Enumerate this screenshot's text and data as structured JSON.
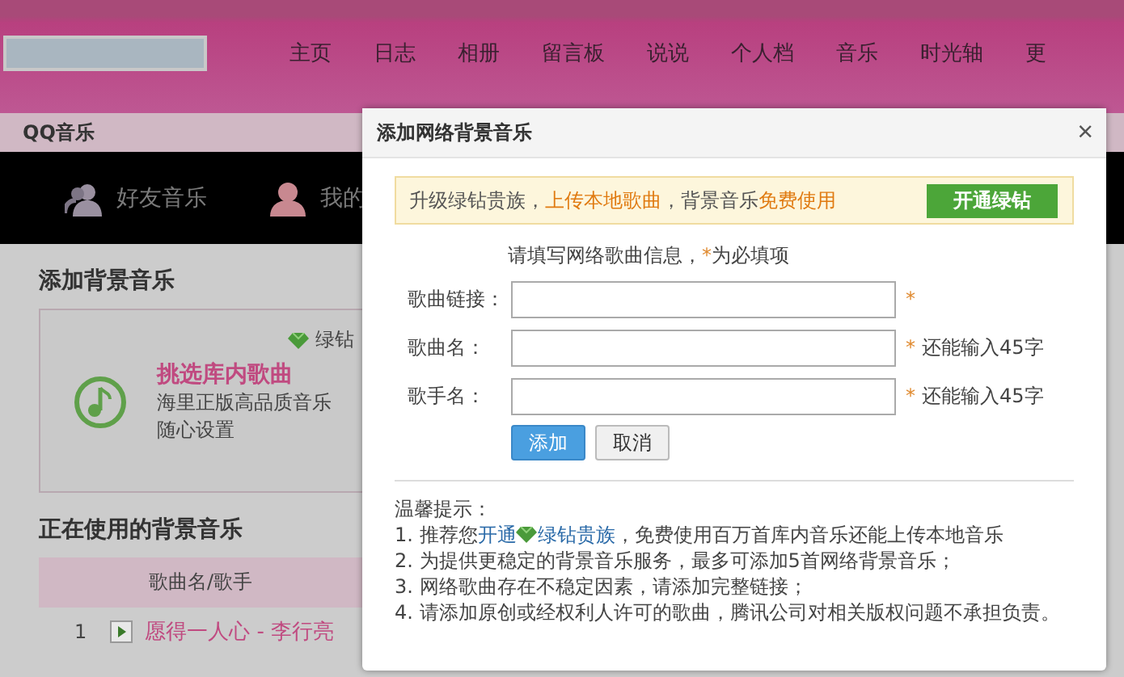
{
  "top_nav": {
    "items": [
      "主页",
      "日志",
      "相册",
      "留言板",
      "说说",
      "个人档",
      "音乐",
      "时光轴",
      "更"
    ]
  },
  "music_panel": {
    "title": "QQ音乐",
    "tabs": [
      {
        "label": "好友音乐",
        "kind": "friends"
      },
      {
        "label": "我的",
        "kind": "mine"
      }
    ],
    "add_section": {
      "heading": "添加背景音乐",
      "badge": "绿钻",
      "card_title": "挑选库内歌曲",
      "card_lines": [
        "海里正版高品质音乐",
        "随心设置"
      ]
    },
    "current_section": {
      "heading": "正在使用的背景音乐",
      "columns": [
        "歌曲名/歌手"
      ],
      "rows": [
        {
          "index": "1",
          "song": "愿得一人心 - 李行亮"
        }
      ]
    }
  },
  "dialog": {
    "title": "添加网络背景音乐",
    "close": "×",
    "promo": {
      "segments": [
        {
          "text": "升级绿钻贵族，",
          "kind": "text"
        },
        {
          "text": "上传本地歌曲",
          "kind": "link"
        },
        {
          "text": "，背景音乐",
          "kind": "text"
        },
        {
          "text": "免费使用",
          "kind": "link"
        }
      ],
      "button": "开通绿钻"
    },
    "intro": [
      {
        "text": "请填写网络歌曲信息，",
        "kind": "text"
      },
      {
        "text": "*",
        "kind": "mark"
      },
      {
        "text": "为必填项",
        "kind": "text"
      }
    ],
    "fields": [
      {
        "label": "歌曲链接：",
        "required": true,
        "star": "*"
      },
      {
        "label": "歌曲名：",
        "required": true,
        "star": "*",
        "counter": "还能输入45字"
      },
      {
        "label": "歌手名：",
        "required": true,
        "star": "*",
        "counter": "还能输入45字"
      }
    ],
    "buttons": [
      {
        "label": "添加",
        "kind": "primary"
      },
      {
        "label": "取消",
        "kind": "secondary"
      }
    ],
    "tips": {
      "title": "温馨提示：",
      "items": [
        [
          {
            "text": "1. 推荐您",
            "kind": "text"
          },
          {
            "text": "开通",
            "kind": "link"
          },
          {
            "kind": "icon"
          },
          {
            "text": "绿钻贵族",
            "kind": "link"
          },
          {
            "text": "，免费使用百万首库内音乐还能上传本地音乐",
            "kind": "text"
          }
        ],
        [
          {
            "text": "2. 为提供更稳定的背景音乐服务，最多可添加5首网络背景音乐；",
            "kind": "text"
          }
        ],
        [
          {
            "text": "3. 网络歌曲存在不稳定因素，请添加完整链接；",
            "kind": "text"
          }
        ],
        [
          {
            "text": "4. 请添加原创或经权利人许可的歌曲，腾讯公司对相关版权问题不承担负责。",
            "kind": "text"
          }
        ]
      ]
    }
  }
}
